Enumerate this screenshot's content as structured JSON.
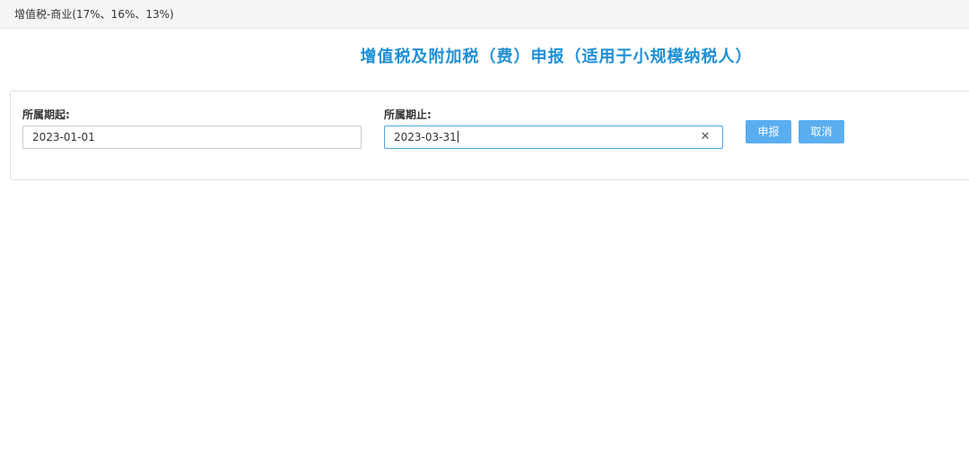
{
  "breadcrumb": {
    "label": "增值税-商业(17%、16%、13%)"
  },
  "page": {
    "title": "增值税及附加税（费）申报（适用于小规模纳税人）"
  },
  "form": {
    "period_start": {
      "label": "所属期起:",
      "value": "2023-01-01"
    },
    "period_end": {
      "label": "所属期止:",
      "value": "2023-03-31"
    },
    "submit_label": "申报",
    "cancel_label": "取消"
  },
  "icons": {
    "clear": "close-icon"
  },
  "colors": {
    "title": "#1e8fd6",
    "button": "#5aaef0",
    "active_border": "#4ca6e8"
  }
}
